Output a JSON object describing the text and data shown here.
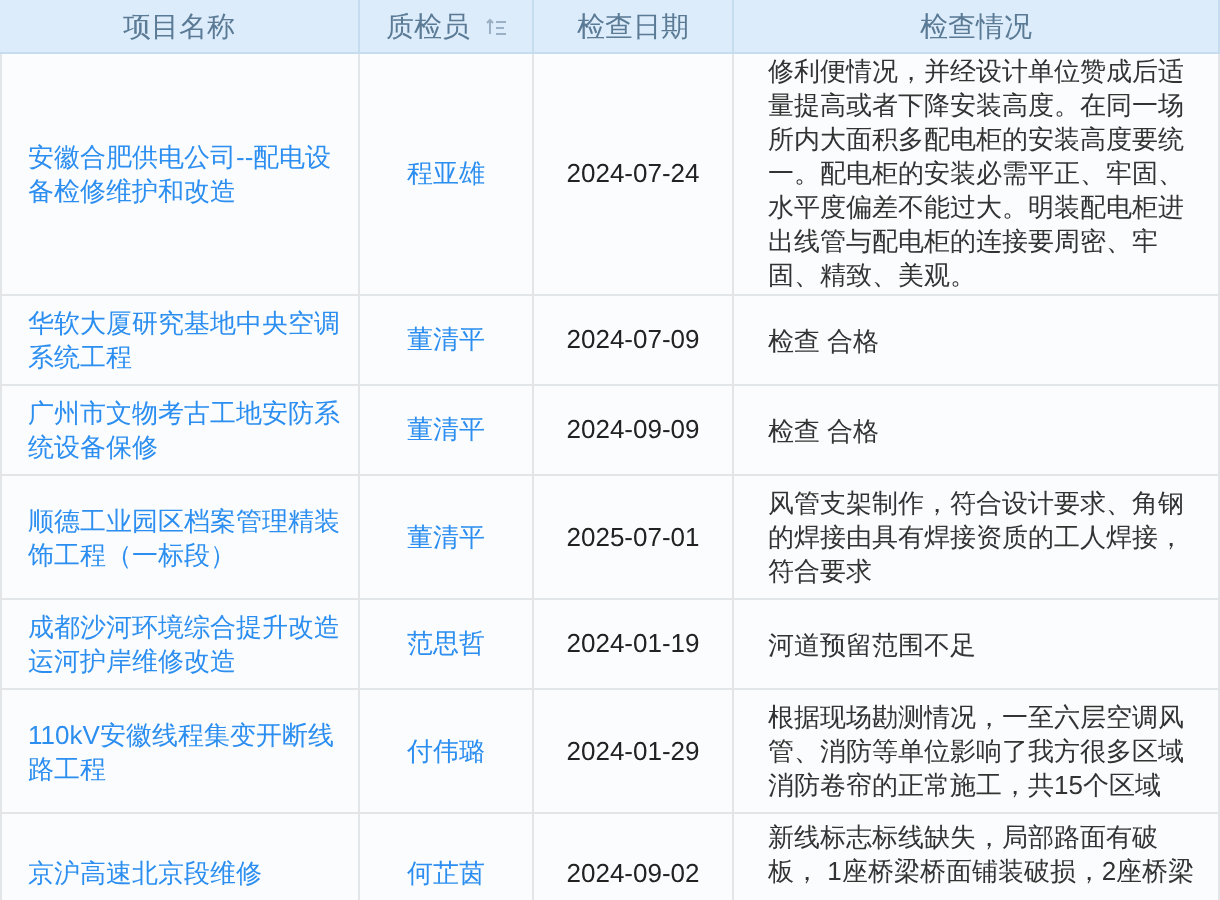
{
  "table": {
    "columns": [
      {
        "label": "项目名称"
      },
      {
        "label": "质检员",
        "sortable": true
      },
      {
        "label": "检查日期"
      },
      {
        "label": "检查情况"
      }
    ],
    "rows": [
      {
        "project": "安徽合肥供电公司--配电设备检修维护和改造",
        "inspector": "程亚雄",
        "date": "2024-07-24",
        "details": "修利便情况，并经设计单位赞成后适量提高或者下降安装高度。在同一场所内大面积多配电柜的安装高度要统一。配电柜的安装必需平正、牢固、水平度偏差不能过大。明装配电柜进出线管与配电柜的连接要周密、牢固、精致、美观。"
      },
      {
        "project": "华软大厦研究基地中央空调系统工程",
        "inspector": "董清平",
        "date": "2024-07-09",
        "details": "检查 合格"
      },
      {
        "project": "广州市文物考古工地安防系统设备保修",
        "inspector": "董清平",
        "date": "2024-09-09",
        "details": "检查 合格"
      },
      {
        "project": "顺德工业园区档案管理精装饰工程（一标段）",
        "inspector": "董清平",
        "date": "2025-07-01",
        "details": "风管支架制作，符合设计要求、角钢的焊接由具有焊接资质的工人焊接，符合要求"
      },
      {
        "project": "成都沙河环境综合提升改造运河护岸维修改造",
        "inspector": "范思哲",
        "date": "2024-01-19",
        "details": "河道预留范围不足"
      },
      {
        "project": "110kV安徽线程集变开断线路工程",
        "inspector": "付伟璐",
        "date": "2024-01-29",
        "details": "根据现场勘测情况，一至六层空调风管、消防等单位影响了我方很多区域消防卷帘的正常施工，共15个区域"
      },
      {
        "project": "京沪高速北京段维修",
        "inspector": "何芷茵",
        "date": "2024-09-02",
        "details": "新线标志标线缺失，局部路面有破板， 1座桥梁桥面铺装破损，2座桥梁"
      }
    ]
  }
}
